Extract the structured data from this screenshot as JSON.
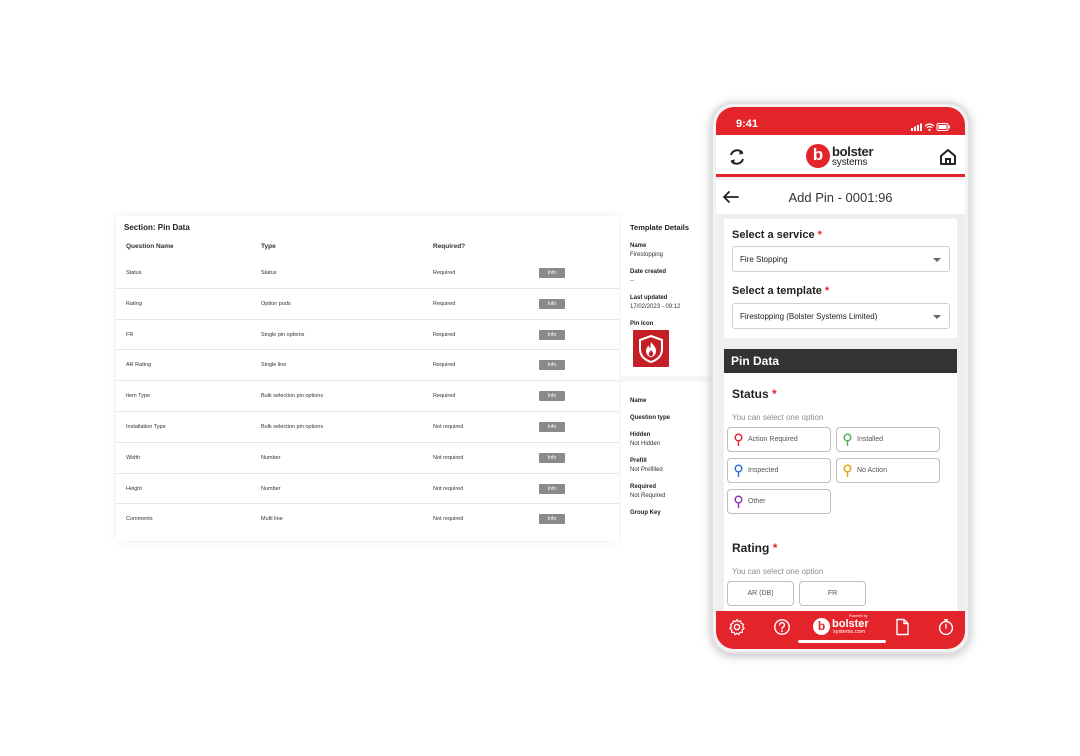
{
  "desktop": {
    "section_title": "Section: Pin Data",
    "columns": {
      "question_name": "Question Name",
      "type": "Type",
      "required": "Required?"
    },
    "rows": [
      {
        "name": "Status",
        "type": "Status",
        "required": "Required",
        "button": "Info"
      },
      {
        "name": "Rating",
        "type": "Option pods",
        "required": "Required",
        "button": "Info"
      },
      {
        "name": "FR",
        "type": "Single pin options",
        "required": "Required",
        "button": "Info"
      },
      {
        "name": "AR Rating",
        "type": "Single line",
        "required": "Required",
        "button": "Info"
      },
      {
        "name": "Item Type",
        "type": "Bulk selection pin options",
        "required": "Required",
        "button": "Info"
      },
      {
        "name": "Installation Type",
        "type": "Bulk selection pin options",
        "required": "Not required",
        "button": "Info"
      },
      {
        "name": "Width",
        "type": "Number",
        "required": "Not required",
        "button": "Info"
      },
      {
        "name": "Height",
        "type": "Number",
        "required": "Not required",
        "button": "Info"
      },
      {
        "name": "Comments",
        "type": "Multi line",
        "required": "Not required",
        "button": "Info"
      }
    ],
    "template_details": {
      "title": "Template Details",
      "name_label": "Name",
      "name_value": "Firestopping",
      "created_label": "Date created",
      "created_value": "--",
      "updated_label": "Last updated",
      "updated_value": "17/02/2023 - 09:12",
      "pin_icon_label": "Pin Icon",
      "pin_icon": "fire-shield-icon"
    },
    "question_details": {
      "name_label": "Name",
      "question_type_label": "Question type",
      "hidden_label": "Hidden",
      "hidden_value": "Not Hidden",
      "prefill_label": "Prefill",
      "prefill_value": "Not Prefilled",
      "required_label": "Required",
      "required_value": "Not Required",
      "group_key_label": "Group Key"
    }
  },
  "phone": {
    "status_time": "9:41",
    "brand_top": "bolster",
    "brand_bottom": "systems",
    "page_title": "Add Pin - 0001:96",
    "service_label": "Select a service",
    "service_value": "Fire Stopping",
    "template_label": "Select a template",
    "template_value": "Firestopping (Bolster Systems Limited)",
    "required_mark": "*",
    "section_header": "Pin Data",
    "status_label": "Status",
    "status_hint": "You can select one option",
    "status_options": [
      {
        "label": "Action Required",
        "color": "#e3242b"
      },
      {
        "label": "Installed",
        "color": "#4caf50"
      },
      {
        "label": "Inspected",
        "color": "#2f6fd0"
      },
      {
        "label": "No Action",
        "color": "#e0a400"
      },
      {
        "label": "Other",
        "color": "#8a2fb8"
      }
    ],
    "rating_label": "Rating",
    "rating_hint": "You can select one option",
    "rating_options": [
      "AR (DB)",
      "FR"
    ],
    "footer_powered": "Powered by",
    "footer_brand": "bolster",
    "footer_brand_sub": "systems.com",
    "accent_color": "#e3242b"
  }
}
